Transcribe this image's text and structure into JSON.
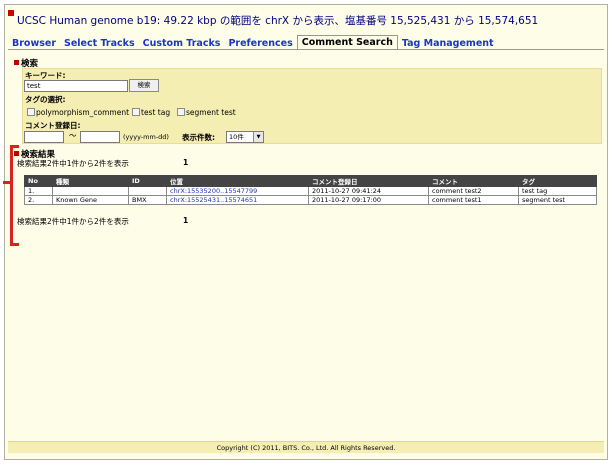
{
  "header": {
    "title": "UCSC Human genome b19: 49.22 kbp の範囲を chrX から表示、塩基番号 15,525,431 から 15,574,651"
  },
  "tabs": [
    {
      "label": "Browser"
    },
    {
      "label": "Select Tracks"
    },
    {
      "label": "Custom Tracks"
    },
    {
      "label": "Preferences"
    },
    {
      "label": "Comment Search"
    },
    {
      "label": "Tag Management"
    }
  ],
  "search": {
    "section_title": "検索",
    "keyword_label": "キーワード:",
    "keyword_value": "test",
    "search_button": "検索",
    "tag_label": "タグの選択:",
    "tags": [
      {
        "label": "polymorphism_comment",
        "checked": false
      },
      {
        "label": "test tag",
        "checked": false
      },
      {
        "label": "segment test",
        "checked": false
      }
    ],
    "date_label": "コメント登録日:",
    "date_from": "",
    "date_separator": "〜",
    "date_to": "",
    "date_format_hint": "(yyyy-mm-dd)",
    "page_size_label": "表示件数:",
    "page_size_value": "10件"
  },
  "results": {
    "section_title": "検索結果",
    "summary_top": "検索結果2件中1件から2件を表示",
    "page_top": "1",
    "summary_bottom": "検索結果2件中1件から2件を表示",
    "page_bottom": "1",
    "columns": [
      "No",
      "種類",
      "ID",
      "位置",
      "コメント登録日",
      "コメント",
      "タグ"
    ],
    "rows": [
      [
        "1.",
        "",
        "",
        "chrX:15535200..15547799",
        "2011-10-27 09:41:24",
        "comment test2",
        "test tag"
      ],
      [
        "2.",
        "Known Gene",
        "BMX",
        "chrX:15525431..15574651",
        "2011-10-27 09:17:00",
        "comment test1",
        "segment test"
      ]
    ]
  },
  "footer": {
    "copyright": "Copyright (C) 2011, BITS. Co., Ltd. All Rights Reserved."
  },
  "colors": {
    "panel_bg": "#f5eeb3",
    "page_bg": "#fdfde8",
    "tab_link": "#1a35c8",
    "table_header": "#444444",
    "annotation_red": "#e02020"
  }
}
